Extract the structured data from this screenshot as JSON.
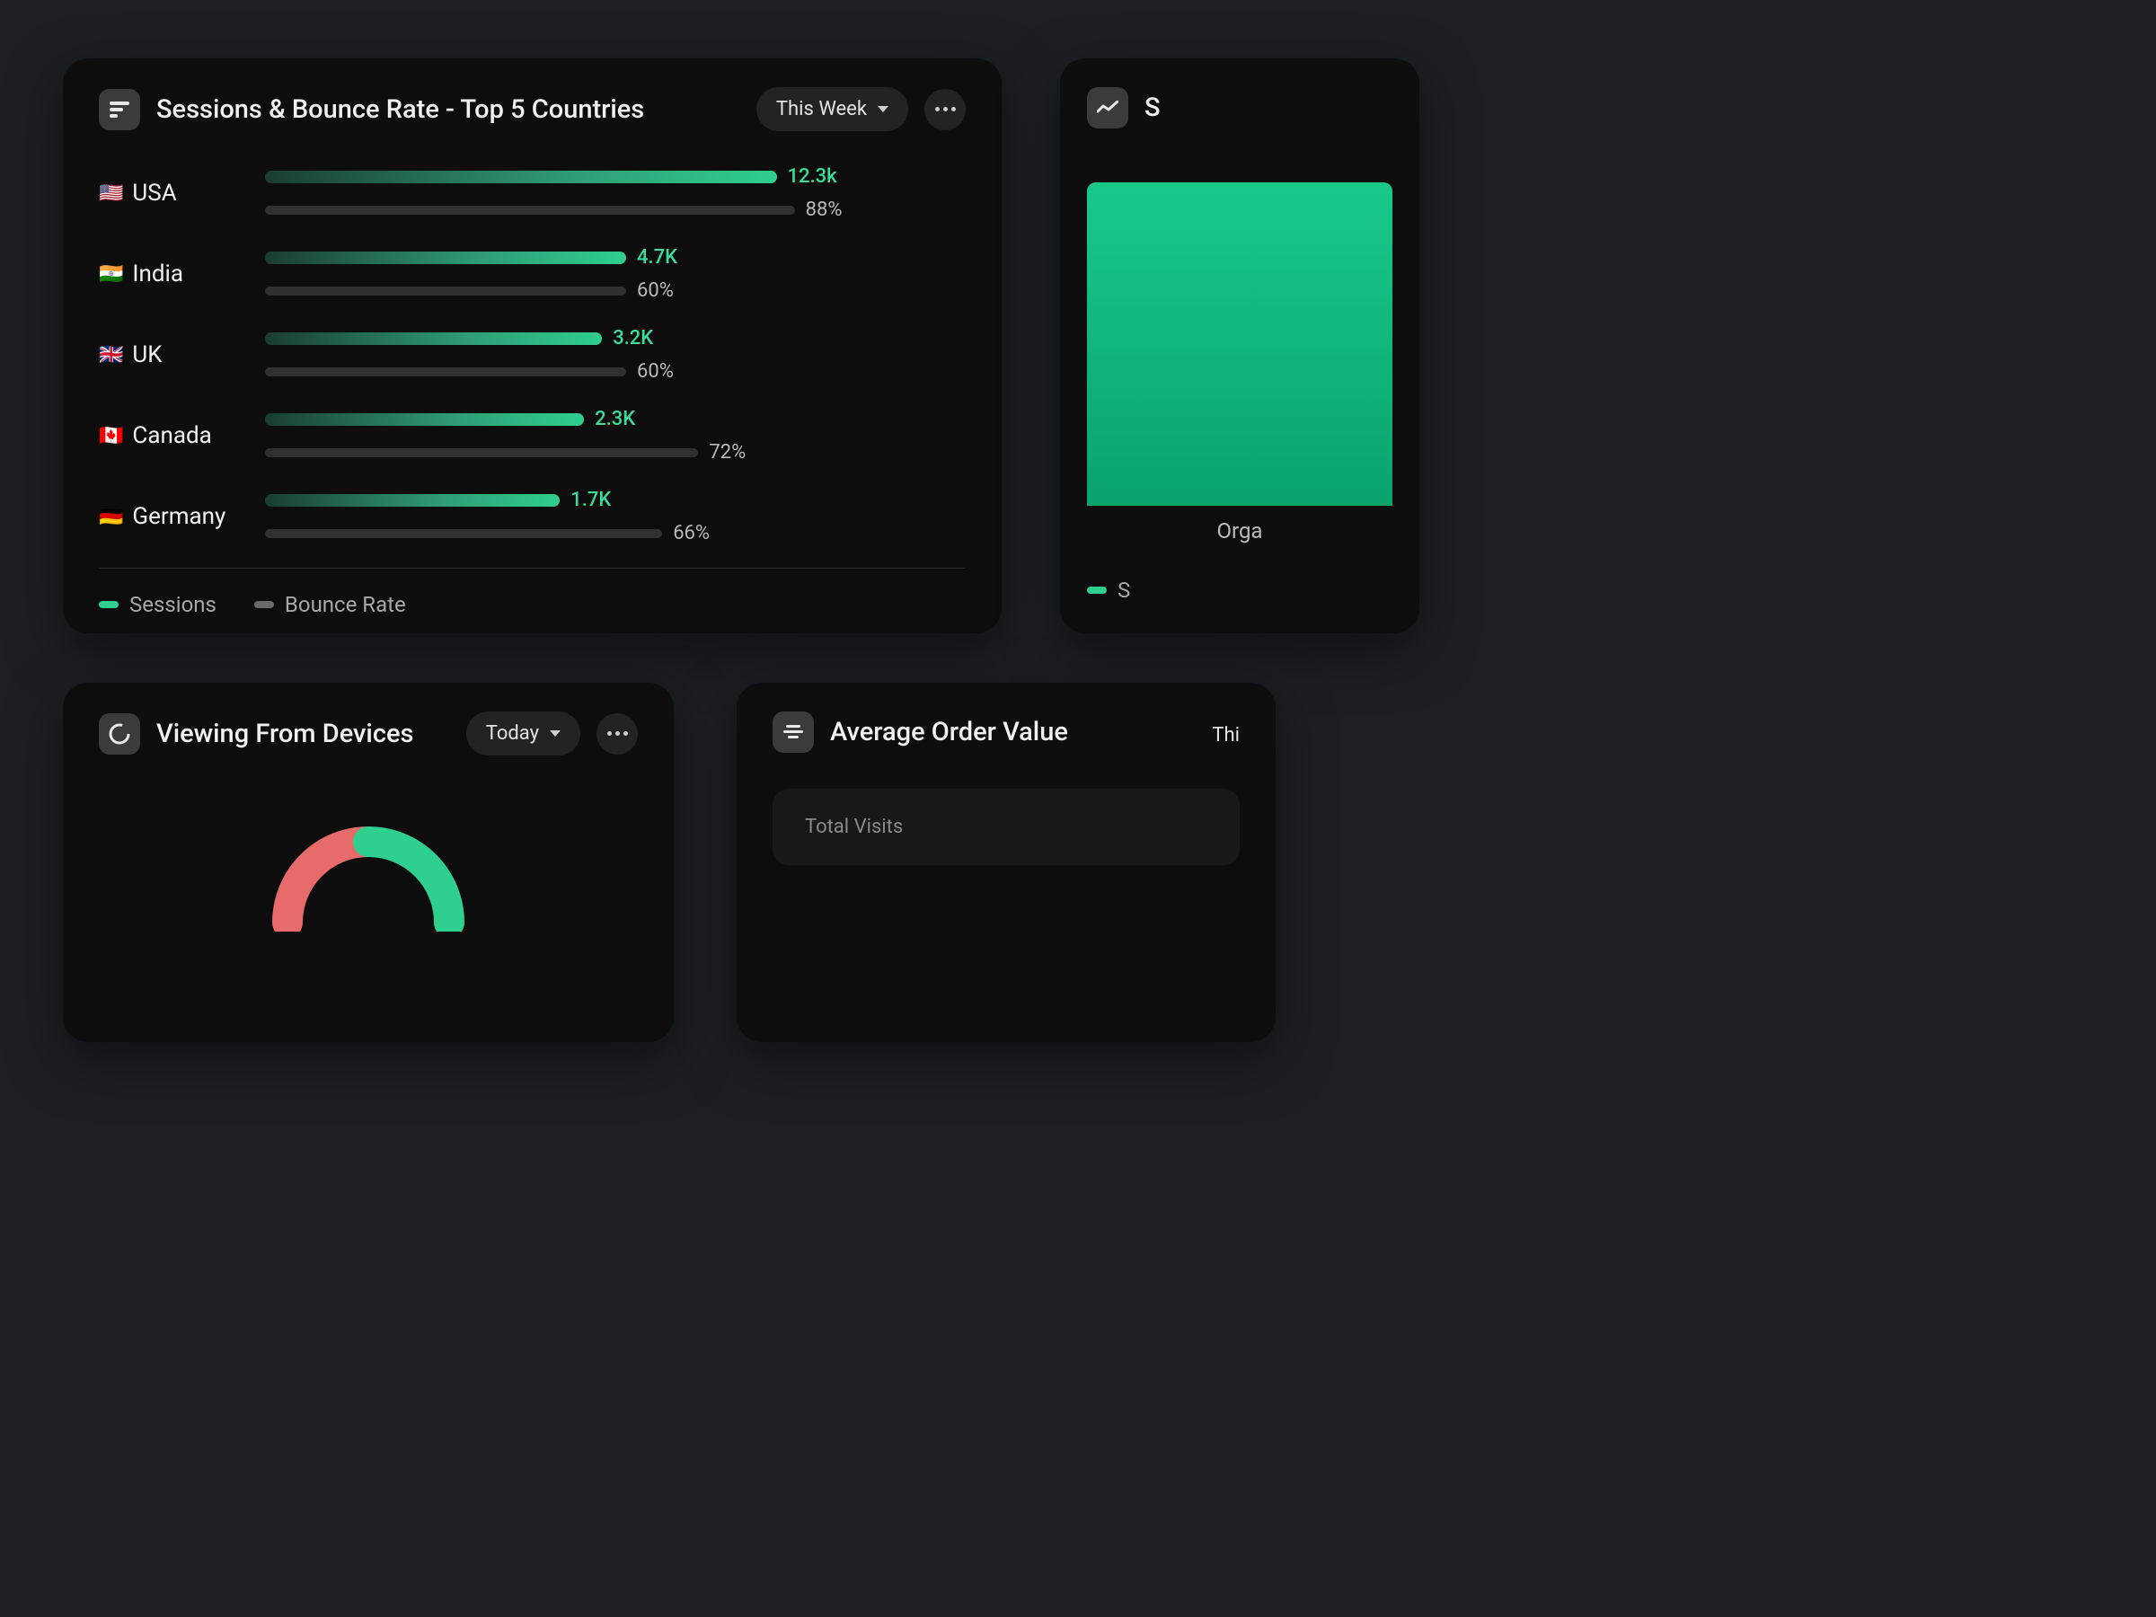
{
  "sessions_card": {
    "title": "Sessions & Bounce Rate - Top 5 Countries",
    "range": "This Week",
    "legend": {
      "sessions": "Sessions",
      "bounce": "Bounce Rate"
    },
    "rows": [
      {
        "flag": "🇺🇸",
        "country": "USA",
        "sessions_label": "12.3k",
        "bounce_label": "88%",
        "sessions_pct": 85,
        "bounce_pct": 88
      },
      {
        "flag": "🇮🇳",
        "country": "India",
        "sessions_label": "4.7K",
        "bounce_label": "60%",
        "sessions_pct": 60,
        "bounce_pct": 60
      },
      {
        "flag": "🇬🇧",
        "country": "UK",
        "sessions_label": "3.2K",
        "bounce_label": "60%",
        "sessions_pct": 56,
        "bounce_pct": 60
      },
      {
        "flag": "🇨🇦",
        "country": "Canada",
        "sessions_label": "2.3K",
        "bounce_label": "72%",
        "sessions_pct": 53,
        "bounce_pct": 72
      },
      {
        "flag": "🇩🇪",
        "country": "Germany",
        "sessions_label": "1.7K",
        "bounce_label": "66%",
        "sessions_pct": 49,
        "bounce_pct": 66
      }
    ]
  },
  "right_card": {
    "title_prefix": "S",
    "tick": "2",
    "xlabel": "Orga",
    "legend_prefix": "S"
  },
  "devices_card": {
    "title": "Viewing From Devices",
    "range": "Today"
  },
  "aov_card": {
    "title": "Average Order Value",
    "range_prefix": "Thi",
    "inner_label": "Total Visits"
  },
  "chart_data": {
    "type": "bar",
    "title": "Sessions & Bounce Rate - Top 5 Countries",
    "categories": [
      "USA",
      "India",
      "UK",
      "Canada",
      "Germany"
    ],
    "series": [
      {
        "name": "Sessions",
        "values": [
          12300,
          4700,
          3200,
          2300,
          1700
        ],
        "unit": "count"
      },
      {
        "name": "Bounce Rate",
        "values": [
          88,
          60,
          60,
          72,
          66
        ],
        "unit": "%"
      }
    ],
    "xlabel": "",
    "ylabel": "",
    "legend": [
      "Sessions",
      "Bounce Rate"
    ]
  }
}
